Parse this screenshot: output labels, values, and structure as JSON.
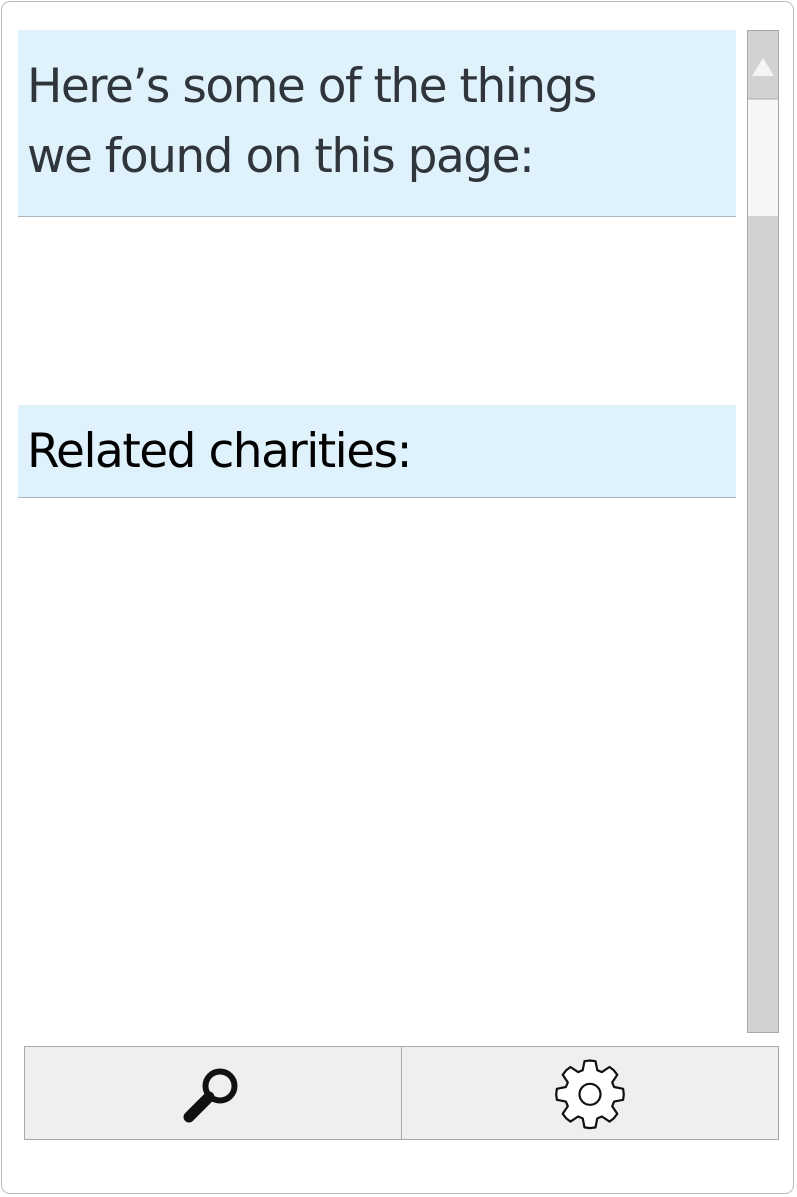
{
  "panel": {
    "found_header_line1": "Here’s some of the things",
    "found_header_line2": "we found on this page:",
    "charities_header": "Related charities:"
  },
  "toolbar": {
    "buttons": [
      {
        "icon": "search-icon"
      },
      {
        "icon": "gear-icon"
      }
    ]
  },
  "colors": {
    "header_background": "#dff2fb",
    "scrollbar_track": "#d1d2d4",
    "toolbar_background": "#eef0ef"
  }
}
